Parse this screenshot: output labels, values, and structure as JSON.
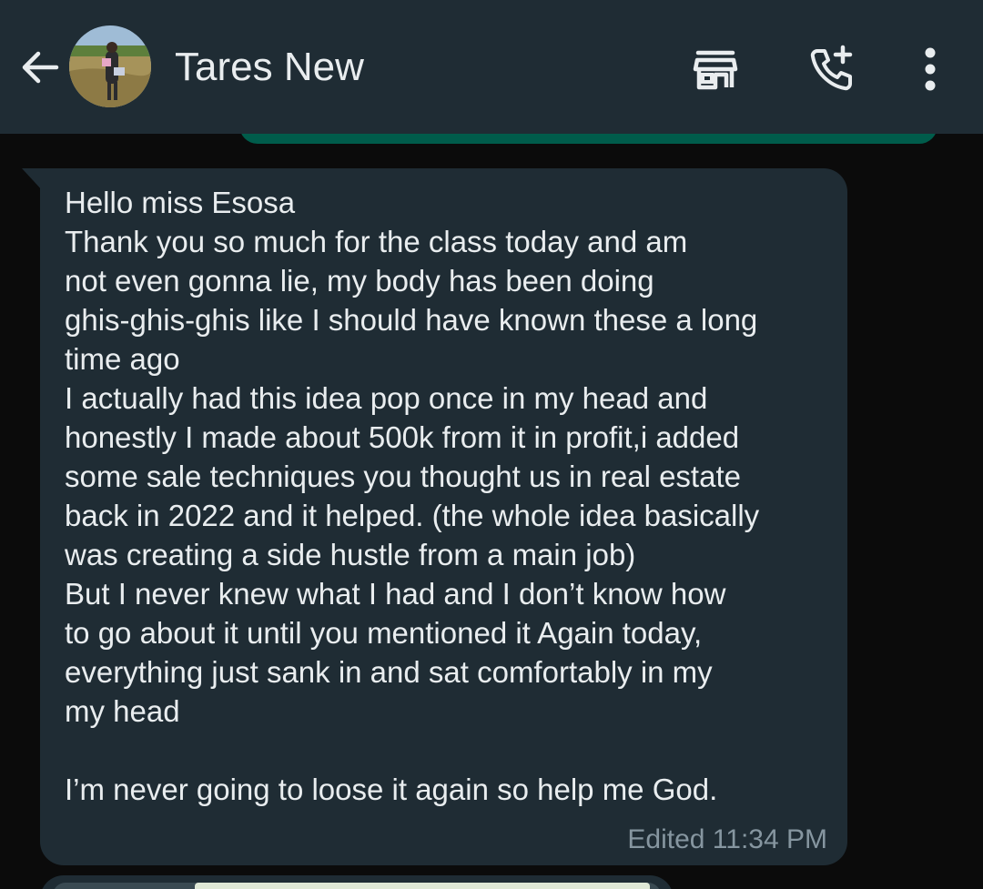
{
  "header": {
    "contact_name": "Tares New",
    "icons": {
      "back": "back-arrow-icon",
      "store": "store-icon",
      "call": "add-call-icon",
      "menu": "more-vert-icon"
    }
  },
  "message": {
    "text": "Hello miss Esosa\nThank you so much for the class today and am\nnot even gonna lie, my body has been doing\nghis-ghis-ghis like I should have known these a long\ntime ago\nI actually had this idea pop once in my head and\nhonestly I made about 500k from it in profit,i added\nsome sale techniques you thought us in real estate\nback in 2022 and it helped. (the whole idea basically\nwas creating a side hustle from a main job)\nBut I never knew what I had and I don’t know how\nto go about it until you mentioned it Again today,\neverything just sank in and sat comfortably in my\nmy head\n\nI’m never going to loose it again so help me God.",
    "meta": "Edited 11:34 PM"
  },
  "colors": {
    "header_bg": "#1f2c34",
    "chat_bg": "#0b0b0b",
    "incoming_bubble": "#1f2c34",
    "outgoing_bubble": "#005c4b",
    "primary_text": "#e9edef",
    "meta_text": "#8696a0"
  }
}
